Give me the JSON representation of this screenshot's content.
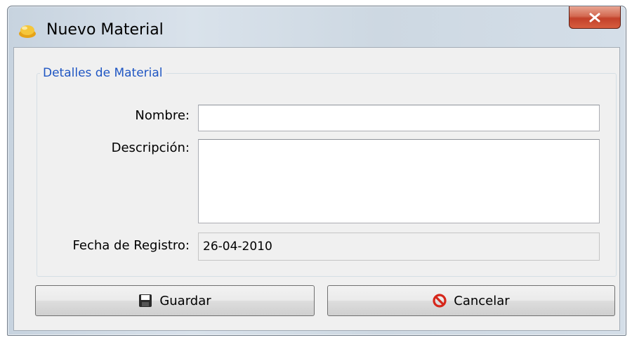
{
  "window": {
    "title": "Nuevo Material",
    "close_glyph": "X"
  },
  "form": {
    "group_title": "Detalles de Material",
    "nombre": {
      "label": "Nombre:",
      "value": ""
    },
    "descripcion": {
      "label": "Descripción:",
      "value": ""
    },
    "fecha": {
      "label": "Fecha de Registro:",
      "value": "26-04-2010"
    }
  },
  "buttons": {
    "save": {
      "label": "Guardar",
      "icon": "floppy-disk-icon"
    },
    "cancel": {
      "label": "Cancelar",
      "icon": "prohibited-icon"
    }
  },
  "colors": {
    "group_title": "#1f56c3",
    "close_button": "#c3412a",
    "cancel_icon": "#d6271b"
  }
}
